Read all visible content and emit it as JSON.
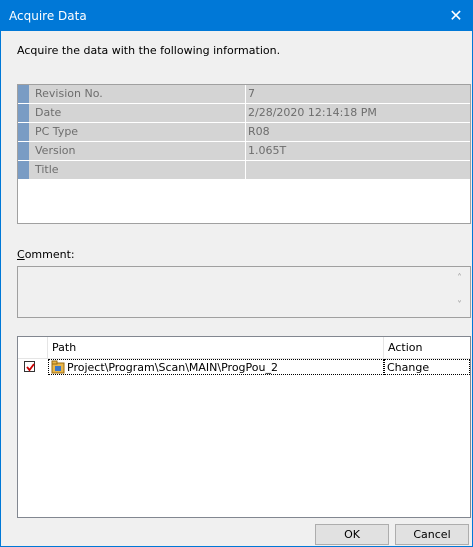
{
  "window": {
    "title": "Acquire Data",
    "close_glyph": "✕"
  },
  "instruction": "Acquire the data with the following information.",
  "info": [
    {
      "key": "Revision No.",
      "value": "7"
    },
    {
      "key": "Date",
      "value": "2/28/2020 12:14:18 PM"
    },
    {
      "key": "PC Type",
      "value": "R08"
    },
    {
      "key": "Version",
      "value": "1.065T"
    },
    {
      "key": "Title",
      "value": ""
    }
  ],
  "comment": {
    "label_rest": "omment:",
    "label_accel": "C",
    "value": ""
  },
  "list": {
    "headers": {
      "check": "",
      "path": "Path",
      "action": "Action"
    },
    "rows": [
      {
        "checked": true,
        "path": "Project\\Program\\Scan\\MAIN\\ProgPou_2",
        "action": "Change",
        "icon": "program-folder-icon"
      }
    ]
  },
  "buttons": {
    "ok": "OK",
    "cancel": "Cancel"
  },
  "colors": {
    "accent": "#0078d7",
    "check": "#cc0000"
  }
}
